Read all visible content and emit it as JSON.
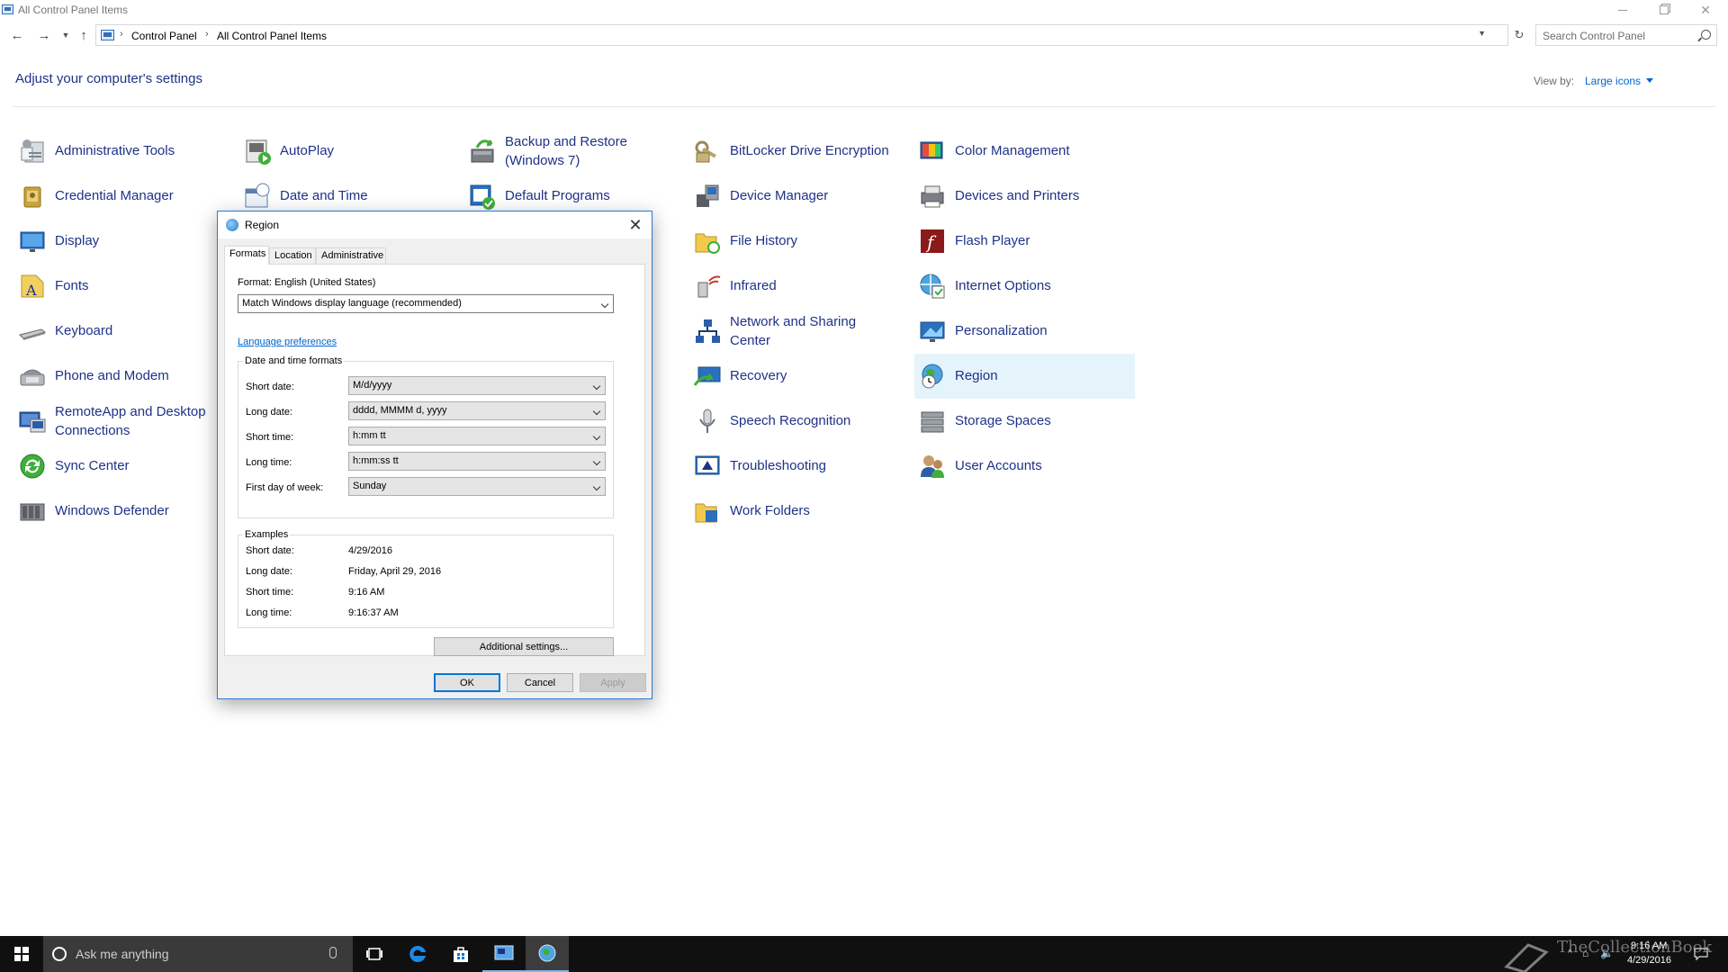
{
  "window": {
    "title": "All Control Panel Items"
  },
  "address_bar": {
    "crumbs": [
      "Control Panel",
      "All Control Panel Items"
    ],
    "search_placeholder": "Search Control Panel"
  },
  "header": {
    "heading": "Adjust your computer's settings",
    "view_by_label": "View by:",
    "view_by_value": "Large icons"
  },
  "items": {
    "administrative_tools": "Administrative Tools",
    "autoplay": "AutoPlay",
    "backup_restore_1": "Backup and Restore",
    "backup_restore_2": "(Windows 7)",
    "bitlocker": "BitLocker Drive Encryption",
    "color_management": "Color Management",
    "credential_manager": "Credential Manager",
    "date_time": "Date and Time",
    "default_programs": "Default Programs",
    "device_manager": "Device Manager",
    "devices_printers": "Devices and Printers",
    "display": "Display",
    "file_history": "File History",
    "flash_player": "Flash Player",
    "fonts": "Fonts",
    "infrared": "Infrared",
    "internet_options": "Internet Options",
    "keyboard": "Keyboard",
    "network_sharing_1": "Network and Sharing",
    "network_sharing_2": "Center",
    "personalization": "Personalization",
    "phone_modem": "Phone and Modem",
    "recovery": "Recovery",
    "region": "Region",
    "remoteapp_1": "RemoteApp and Desktop",
    "remoteapp_2": "Connections",
    "speech_recognition": "Speech Recognition",
    "storage_spaces": "Storage Spaces",
    "sync_center": "Sync Center",
    "troubleshooting": "Troubleshooting",
    "user_accounts": "User Accounts",
    "windows_defender": "Windows Defender",
    "work_folders": "Work Folders"
  },
  "dialog": {
    "title": "Region",
    "tabs": [
      "Formats",
      "Location",
      "Administrative"
    ],
    "format_label": "Format: English (United States)",
    "format_value": "Match Windows display language (recommended)",
    "language_link": "Language preferences",
    "datetime_group": "Date and time formats",
    "fields": [
      {
        "label": "Short date:",
        "value": "M/d/yyyy"
      },
      {
        "label": "Long date:",
        "value": "dddd, MMMM d, yyyy"
      },
      {
        "label": "Short time:",
        "value": "h:mm tt"
      },
      {
        "label": "Long time:",
        "value": "h:mm:ss tt"
      },
      {
        "label": "First day of week:",
        "value": "Sunday"
      }
    ],
    "examples_group": "Examples",
    "examples": [
      {
        "label": "Short date:",
        "value": "4/29/2016"
      },
      {
        "label": "Long date:",
        "value": "Friday, April 29, 2016"
      },
      {
        "label": "Short time:",
        "value": "9:16 AM"
      },
      {
        "label": "Long time:",
        "value": "9:16:37 AM"
      }
    ],
    "additional_settings": "Additional settings...",
    "ok": "OK",
    "cancel": "Cancel",
    "apply": "Apply"
  },
  "taskbar": {
    "search_text": "Ask me anything",
    "time": "9:16 AM",
    "date": "4/29/2016",
    "watermark": "TheCollectionBook"
  },
  "colors": {
    "link_blue": "#1e3287",
    "accent": "#0078d7",
    "selection": "#e5f3fb",
    "taskbar": "#101010"
  }
}
